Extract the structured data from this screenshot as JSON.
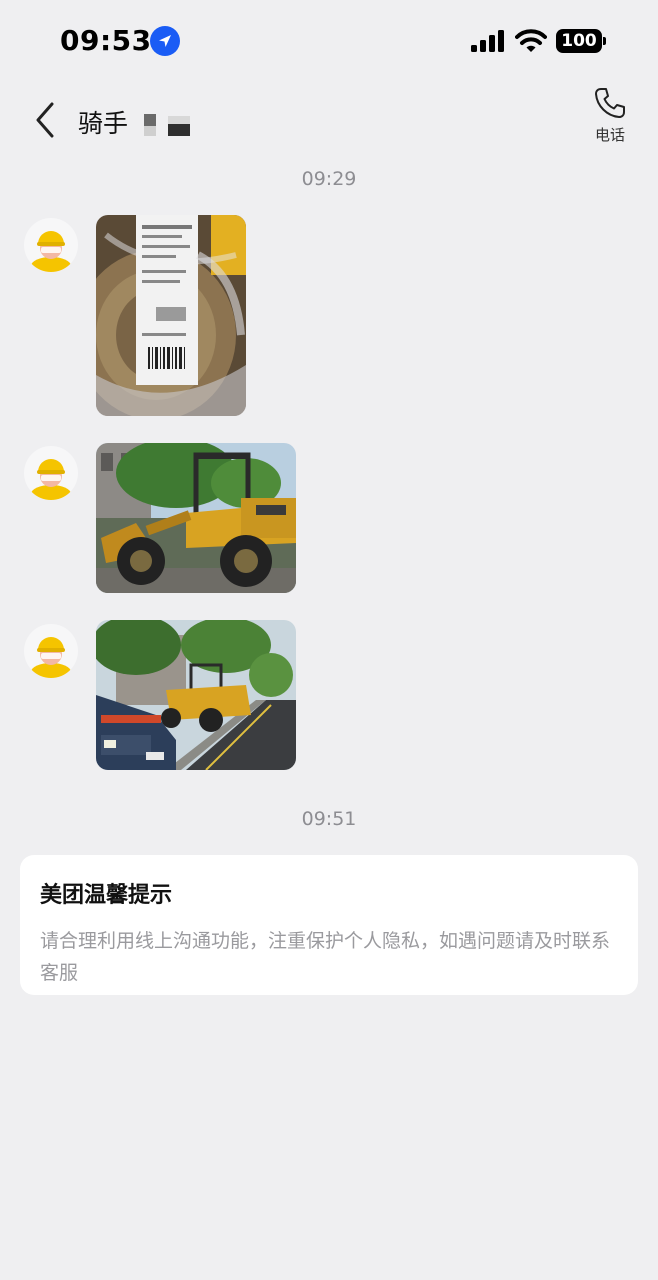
{
  "status_bar": {
    "time": "09:53",
    "battery": "100"
  },
  "header": {
    "title": "骑手",
    "call_label": "电话"
  },
  "timestamps": [
    "09:29",
    "09:51"
  ],
  "tip": {
    "title": "美团温馨提示",
    "body": "请合理利用线上沟通功能，注重保护个人隐私，如遇问题请及时联系客服"
  },
  "colors": {
    "background": "#efeff1",
    "location_blue": "#1a5cf5",
    "avatar_helmet": "#f5c400"
  },
  "icons": [
    "location-arrow-icon",
    "cellular-signal-icon",
    "wifi-icon",
    "battery-icon",
    "back-chevron-icon",
    "phone-icon"
  ]
}
